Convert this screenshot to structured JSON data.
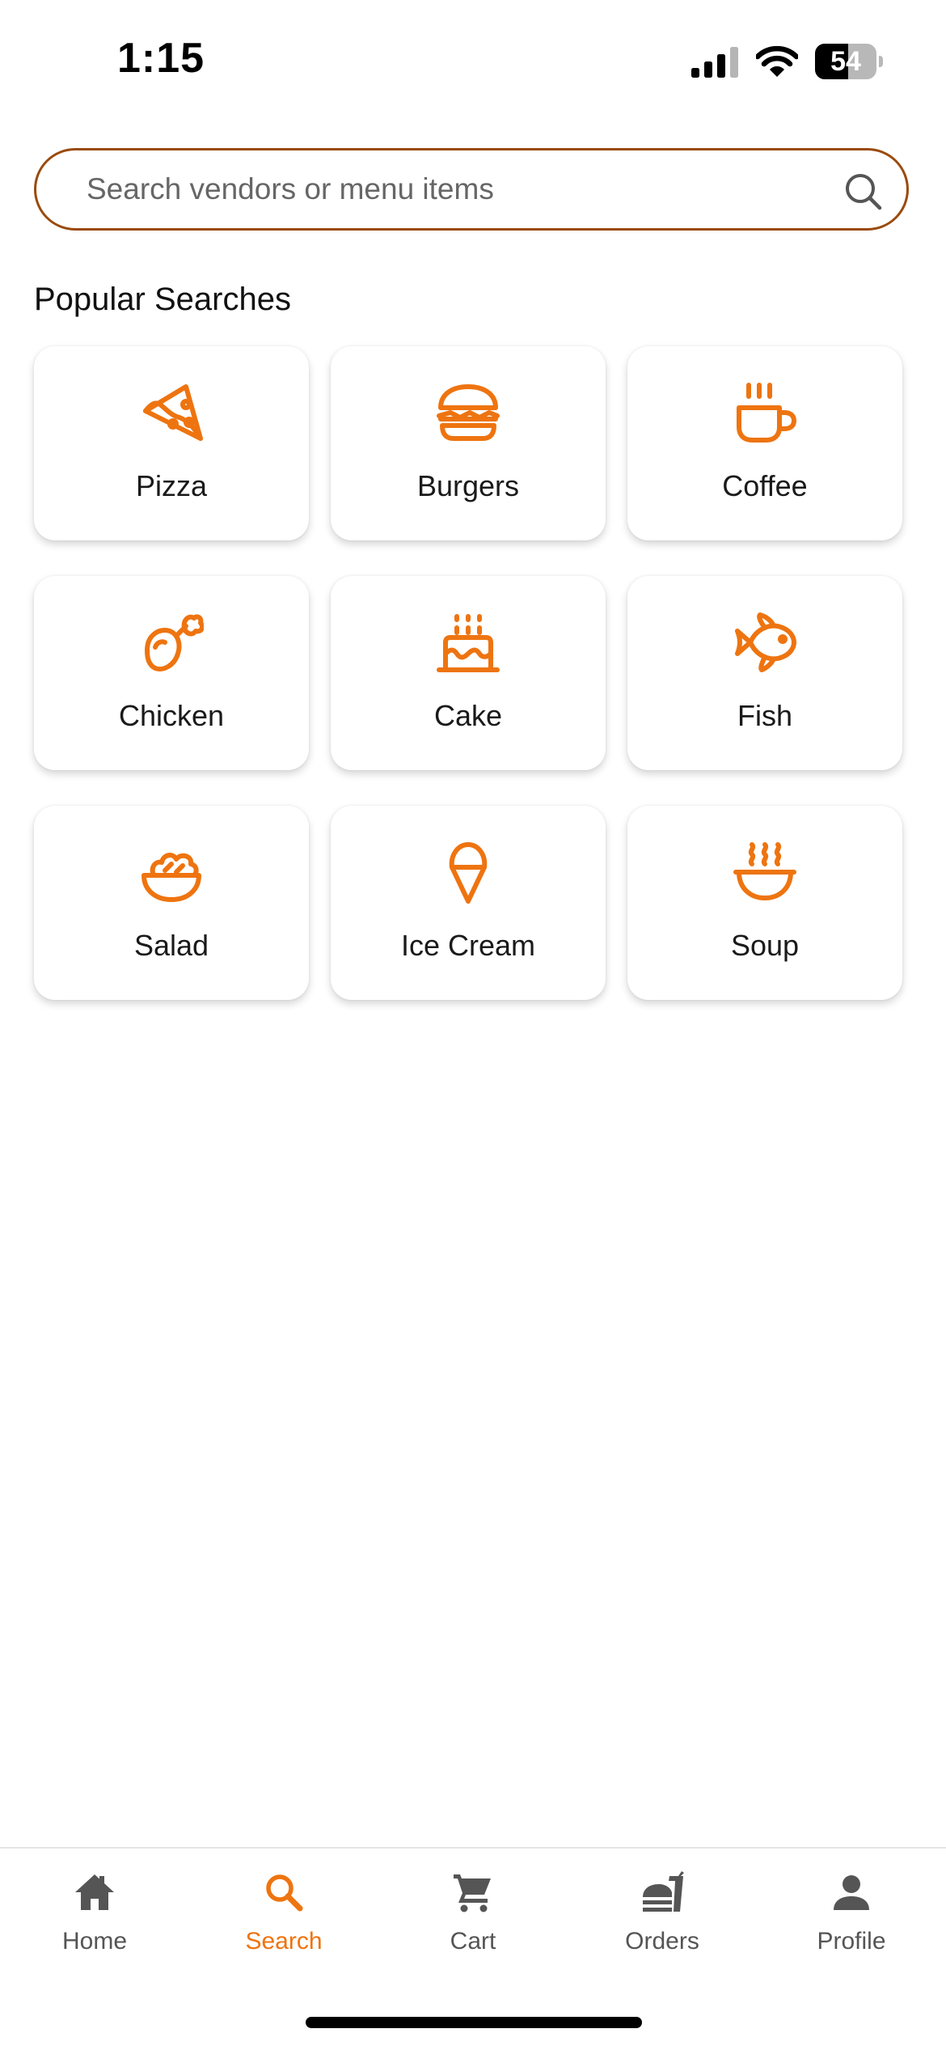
{
  "status_bar": {
    "time": "1:15",
    "battery_level": "54"
  },
  "search": {
    "placeholder": "Search vendors or menu items",
    "value": ""
  },
  "popular": {
    "title": "Popular Searches",
    "items": [
      {
        "label": "Pizza",
        "icon": "pizza-icon"
      },
      {
        "label": "Burgers",
        "icon": "burger-icon"
      },
      {
        "label": "Coffee",
        "icon": "coffee-icon"
      },
      {
        "label": "Chicken",
        "icon": "chicken-leg-icon"
      },
      {
        "label": "Cake",
        "icon": "cake-icon"
      },
      {
        "label": "Fish",
        "icon": "fish-icon"
      },
      {
        "label": "Salad",
        "icon": "salad-bowl-icon"
      },
      {
        "label": "Ice Cream",
        "icon": "ice-cream-icon"
      },
      {
        "label": "Soup",
        "icon": "soup-bowl-icon"
      }
    ]
  },
  "bottom_nav": {
    "active": "Search",
    "items": [
      {
        "label": "Home",
        "icon": "home-icon"
      },
      {
        "label": "Search",
        "icon": "search-icon"
      },
      {
        "label": "Cart",
        "icon": "cart-icon"
      },
      {
        "label": "Orders",
        "icon": "orders-icon"
      },
      {
        "label": "Profile",
        "icon": "profile-icon"
      }
    ]
  },
  "colors": {
    "accent": "#ee7410",
    "search_border": "#9a4a0c",
    "nav_inactive": "#555555"
  }
}
